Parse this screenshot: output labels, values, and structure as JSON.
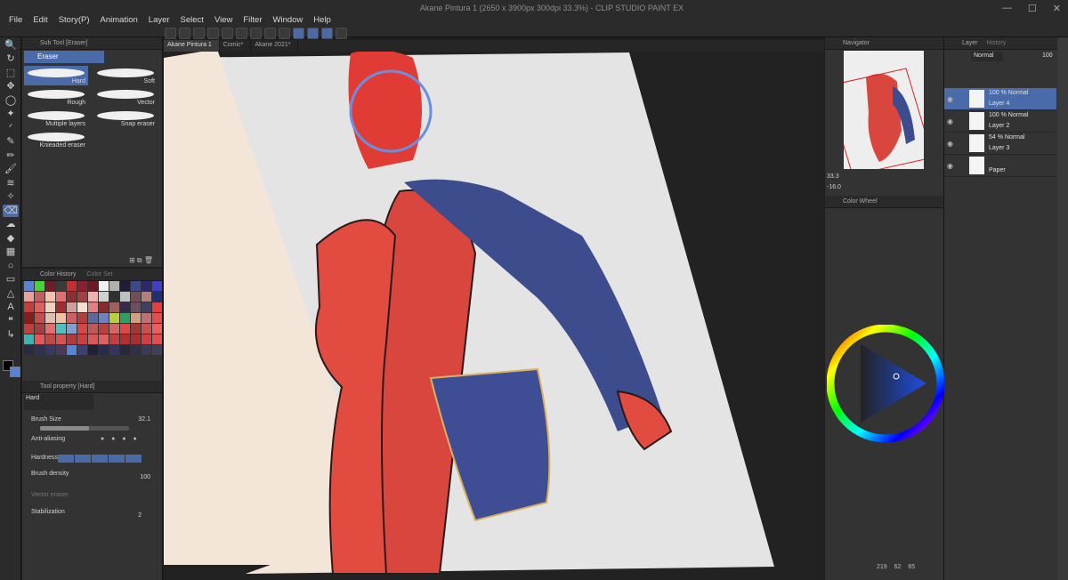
{
  "window": {
    "title": "Akane Pintura 1 (2650 x 3900px 300dpi 33.3%) - CLIP STUDIO PAINT EX",
    "controls": [
      "—",
      "☐",
      "✕"
    ]
  },
  "menu": [
    "File",
    "Edit",
    "Story(P)",
    "Animation",
    "Layer",
    "Select",
    "View",
    "Filter",
    "Window",
    "Help"
  ],
  "toolbar": {
    "tools": [
      "search-icon",
      "rotate-icon",
      "lasso-select-icon",
      "move-icon",
      "lasso-icon",
      "wand-icon",
      "eyedropper-icon",
      "pen-icon",
      "pencil-icon",
      "brush-icon",
      "airbrush-icon",
      "decoration-icon",
      "eraser-icon",
      "blend-icon",
      "fill-icon",
      "gradient-icon",
      "shape-icon",
      "frame-icon",
      "ruler-icon",
      "text-icon",
      "balloon-icon",
      "correct-line-icon"
    ],
    "selected_index": 12,
    "foreground_color": "#000000",
    "background_color": "#5a83d6"
  },
  "subtool": {
    "header": "Sub Tool [Eraser]",
    "group_tab": "Eraser",
    "brushes": [
      {
        "label": "Hard",
        "selected": true
      },
      {
        "label": "Soft",
        "selected": false
      },
      {
        "label": "Rough",
        "selected": false
      },
      {
        "label": "Vector",
        "selected": false
      },
      {
        "label": "Multiple layers",
        "selected": false
      },
      {
        "label": "Snap eraser",
        "selected": false
      },
      {
        "label": "Knieaded eraser",
        "selected": false
      }
    ]
  },
  "color_history": {
    "tabs": [
      "Color History",
      "Color Set"
    ],
    "swatches": [
      "#5a83d6",
      "#4ad13a",
      "#6b1e2a",
      "#3a3a3a",
      "#c03030",
      "#8a2030",
      "#6e1a22",
      "#f0f0f0",
      "#b0b0b0",
      "#1e1e3a",
      "#3a4a8a",
      "#2a2a6a",
      "#4040c0",
      "#e8a0a0",
      "#c06060",
      "#f4c0b0",
      "#e07070",
      "#8a3030",
      "#a04040",
      "#f0b0b0",
      "#d0d0d0",
      "#303030",
      "#c0c0c0",
      "#705050",
      "#b08080",
      "#203070",
      "#c04040",
      "#e06060",
      "#f0d0c0",
      "#a03030",
      "#d0a0a0",
      "#f4e0d0",
      "#e08080",
      "#8a2a2a",
      "#a06060",
      "#3a2a4a",
      "#6a5060",
      "#404060",
      "#e04040",
      "#802020",
      "#c05050",
      "#e0c0b0",
      "#f0c0a0",
      "#d06060",
      "#b04040",
      "#5a6a9a",
      "#7080c0",
      "#b8d040",
      "#30a060",
      "#d0a080",
      "#c07070",
      "#e05050",
      "#c04040",
      "#a04040",
      "#e07070",
      "#50c0c0",
      "#80a0d0",
      "#d04848",
      "#c05858",
      "#b84040",
      "#d06868",
      "#e04848",
      "#a03838",
      "#c85050",
      "#e86060",
      "#40b0b0",
      "#e05858",
      "#c04848",
      "#d85050",
      "#b83838",
      "#c84040",
      "#d85858",
      "#e06060",
      "#c04040",
      "#b03030",
      "#a83030",
      "#d04040",
      "#e05050",
      "#2a2a40",
      "#303050",
      "#383860",
      "#4a3a5a",
      "#5a83d6",
      "#404070",
      "#202038",
      "#2a2a4a",
      "#353560",
      "#28283c",
      "#303048",
      "#3a3a55",
      "#404058"
    ]
  },
  "tool_property": {
    "header": "Tool property [Hard]",
    "preset_name": "Hard",
    "brush_size_label": "Brush Size",
    "brush_size_value": "32.1",
    "brush_size_fraction": 0.55,
    "anti_aliasing_label": "Anti-aliasing",
    "hardness_label": "Hardness",
    "brush_density_label": "Brush density",
    "brush_density_value": "100",
    "vector_eraser_label": "Vector eraser",
    "stabilization_label": "Stabilization",
    "stabilization_value": "2"
  },
  "doc_tabs": [
    {
      "label": "Akane Pintura 1",
      "active": true
    },
    {
      "label": "Comic*",
      "active": false
    },
    {
      "label": "Akane 2021*",
      "active": false
    }
  ],
  "navigator": {
    "header": "Navigator",
    "zoom": "33.3",
    "rotation": "-16.0"
  },
  "color_wheel": {
    "header": "Color Wheel"
  },
  "layer_panel": {
    "tabs": [
      "Layer",
      "History"
    ],
    "blend_mode": "Normal",
    "opacity": "100",
    "layers": [
      {
        "name": "Layer 4",
        "opacity": "100 % Normal",
        "selected": true
      },
      {
        "name": "Layer 2",
        "opacity": "100 % Normal",
        "selected": false
      },
      {
        "name": "Layer 3",
        "opacity": "54 % Normal",
        "selected": false
      },
      {
        "name": "Paper",
        "opacity": "",
        "selected": false
      }
    ]
  },
  "status": {
    "x": "219",
    "y": "62",
    "z": "65"
  }
}
